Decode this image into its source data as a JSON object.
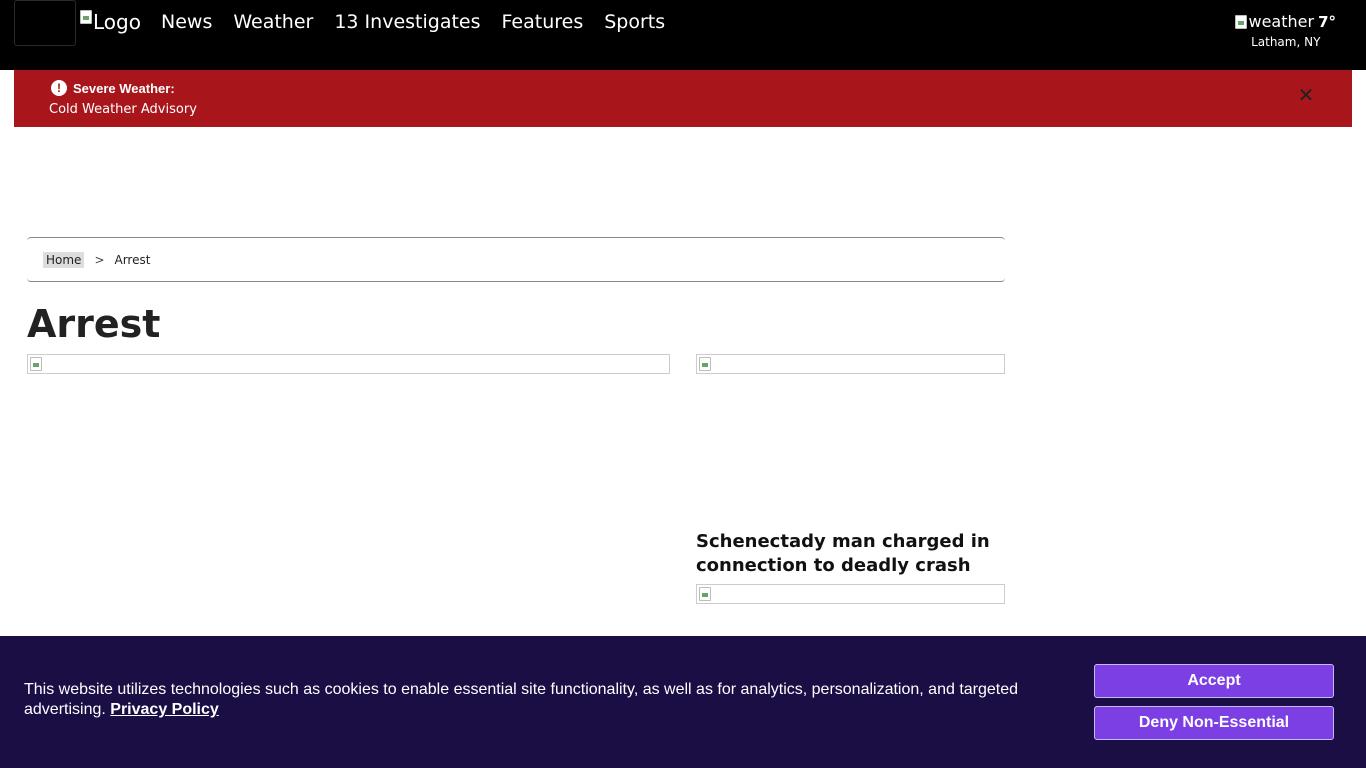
{
  "header": {
    "logo_alt": "Logo",
    "nav": [
      {
        "label": "News"
      },
      {
        "label": "Weather"
      },
      {
        "label": "13 Investigates"
      },
      {
        "label": "Features"
      },
      {
        "label": "Sports"
      }
    ],
    "weather": {
      "icon_alt": "weather",
      "temp": "7°",
      "location": "Latham, NY"
    }
  },
  "alert": {
    "title": "Severe Weather:",
    "text": "Cold Weather Advisory",
    "close_icon": "close-icon"
  },
  "breadcrumb": {
    "home": "Home",
    "separator": ">",
    "current": "Arrest"
  },
  "page": {
    "title": "Arrest"
  },
  "articles": [
    {
      "headline": "Schenectady man charged in connection to deadly crash"
    }
  ],
  "cookie_banner": {
    "text": "This website utilizes technologies such as cookies to enable essential site functionality, as well as for analytics, personalization, and targeted advertising.",
    "policy_link": "Privacy Policy",
    "accept_label": "Accept",
    "deny_label": "Deny Non-Essential"
  },
  "colors": {
    "navbar": "#000000",
    "alert": "#a8161b",
    "cookie_bg": "#1a0e45",
    "button": "#7b3fe4"
  }
}
